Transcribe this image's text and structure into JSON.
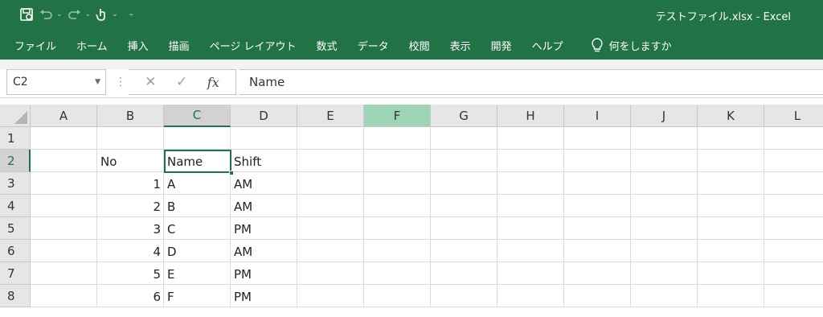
{
  "window": {
    "title": "テストファイル.xlsx  -  Excel"
  },
  "quick_access": {
    "icons": [
      "autosave-icon",
      "undo-icon",
      "redo-icon",
      "touch-mode-icon",
      "customize-icon"
    ]
  },
  "ribbon": {
    "tabs": [
      "ファイル",
      "ホーム",
      "挿入",
      "描画",
      "ページ レイアウト",
      "数式",
      "データ",
      "校閲",
      "表示",
      "開発",
      "ヘルプ"
    ],
    "tell_me": "何をしますか"
  },
  "formula_bar": {
    "name_box": "C2",
    "fx_label": "fx",
    "cancel_glyph": "✕",
    "enter_glyph": "✓",
    "content": "Name"
  },
  "sheet": {
    "columns": [
      "A",
      "B",
      "C",
      "D",
      "E",
      "F",
      "G",
      "H",
      "I",
      "J",
      "K",
      "L"
    ],
    "selected_column": "C",
    "highlighted_column": "F",
    "rows": [
      "1",
      "2",
      "3",
      "4",
      "5",
      "6",
      "7",
      "8"
    ],
    "selected_row": "2",
    "active_cell": "C2",
    "cells": {
      "B2": "No",
      "C2": "Name",
      "D2": "Shift",
      "B3": "1",
      "C3": "A",
      "D3": "AM",
      "B4": "2",
      "C4": "B",
      "D4": "AM",
      "B5": "3",
      "C5": "C",
      "D5": "PM",
      "B6": "4",
      "C6": "D",
      "D6": "AM",
      "B7": "5",
      "C7": "E",
      "D7": "PM",
      "B8": "6",
      "C8": "F",
      "D8": "PM"
    },
    "numeric_cells": [
      "B3",
      "B4",
      "B5",
      "B6",
      "B7",
      "B8"
    ]
  },
  "colors": {
    "accent": "#217346",
    "column_highlight": "#9fd5b7"
  }
}
